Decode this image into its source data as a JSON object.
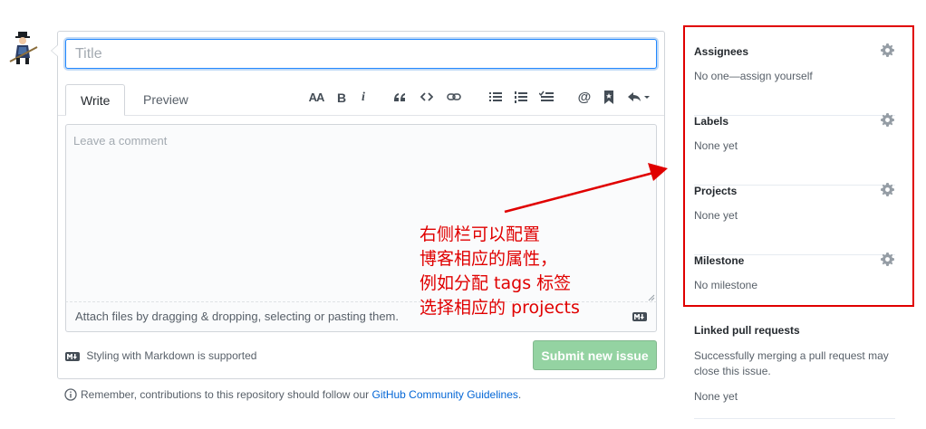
{
  "form": {
    "title_placeholder": "Title",
    "tabs": [
      {
        "label": "Write"
      },
      {
        "label": "Preview"
      }
    ],
    "toolbar": {
      "heading": "AA",
      "bold": "B",
      "italic": "i",
      "mention": "@"
    },
    "comment_placeholder": "Leave a comment",
    "attach_text": "Attach files by dragging & dropping, selecting or pasting them.",
    "styling_hint": "Styling with Markdown is supported",
    "submit_label": "Submit new issue"
  },
  "footer": {
    "remember_text": "Remember, contributions to this repository should follow our ",
    "guidelines_link": "GitHub Community Guidelines",
    "period": "."
  },
  "sidebar": {
    "assignees": {
      "title": "Assignees",
      "value": "No one—assign yourself"
    },
    "labels": {
      "title": "Labels",
      "value": "None yet"
    },
    "projects": {
      "title": "Projects",
      "value": "None yet"
    },
    "milestone": {
      "title": "Milestone",
      "value": "No milestone"
    },
    "linked": {
      "title": "Linked pull requests",
      "description": "Successfully merging a pull request may close this issue.",
      "value": "None yet"
    }
  },
  "annotation": {
    "text": "右侧栏可以配置\n博客相应的属性，\n例如分配 tags 标签\n选择相应的 projects",
    "color": "#e00000"
  },
  "colors": {
    "accent": "#0366d6",
    "submit_disabled": "#94d3a2",
    "highlight": "#e00000"
  }
}
